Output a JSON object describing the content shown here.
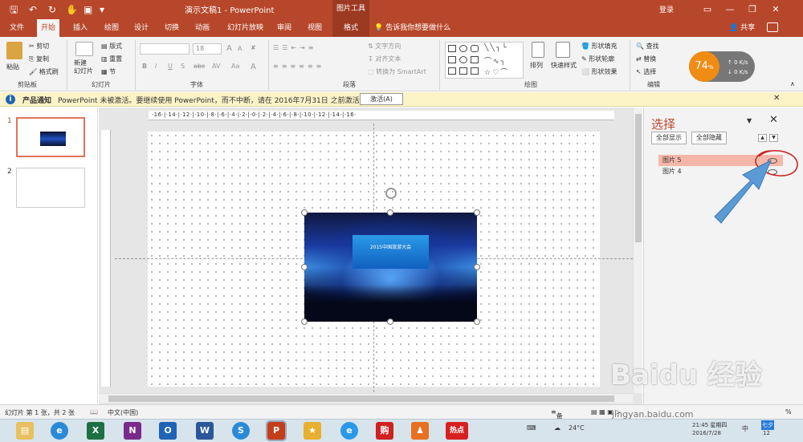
{
  "titlebar": {
    "title": "演示文稿1 - PowerPoint",
    "picture_tools": "图片工具",
    "login": "登录",
    "quick_access": [
      "save-icon",
      "undo-icon",
      "redo-icon",
      "touch-mode-icon",
      "customize-icon"
    ]
  },
  "tabs": {
    "file": "文件",
    "home": "开始",
    "insert": "插入",
    "draw": "绘图",
    "design": "设计",
    "transitions": "切换",
    "animations": "动画",
    "slideshow": "幻灯片放映",
    "review": "审阅",
    "view": "视图",
    "format": "格式",
    "tell_me": "告诉我你想要做什么",
    "share": "共享"
  },
  "ribbon": {
    "clipboard": {
      "label": "剪贴板",
      "paste": "粘贴",
      "cut": "剪切",
      "copy": "复制",
      "format_painter": "格式刷"
    },
    "slides": {
      "label": "幻灯片",
      "new_slide": "新建\n幻灯片",
      "layout": "版式",
      "reset": "重置",
      "section": "节"
    },
    "font": {
      "label": "字体",
      "font_name": "",
      "font_size": "18",
      "bold": "B",
      "italic": "I",
      "underline": "U",
      "strike": "S",
      "abc": "abc",
      "av": "AV",
      "aa": "Aa",
      "grow": "A",
      "shrink": "A"
    },
    "paragraph": {
      "label": "段落",
      "text_direction": "文字方向",
      "align_text": "对齐文本",
      "smartart": "转换为 SmartArt"
    },
    "drawing": {
      "label": "绘图",
      "arrange": "排列",
      "quick_styles": "快速样式",
      "fill": "形状填充",
      "outline": "形状轮廓",
      "effects": "形状效果"
    },
    "editing": {
      "label": "编辑",
      "find": "查找",
      "replace": "替换",
      "select": "选择"
    },
    "gauge": {
      "percent": "74",
      "percent_sign": "%",
      "up": "0 K/s",
      "down": "0 K/s"
    }
  },
  "notice": {
    "label": "产品通知",
    "message": "PowerPoint 未被激活。要继续使用 PowerPoint，而不中断，请在 2016年7月31日 之前激活。",
    "button": "激活(A)"
  },
  "thumbnails": {
    "first": "1",
    "second": "2"
  },
  "ruler": {
    "ticks": "·16·|·14·|·12·|·10·|·8·|·6·|·4·|·2·|·0·|·2·|·4·|·6·|·8·|·10·|·12·|·14·|·16·"
  },
  "photo": {
    "banner": "2015中国旅游大会"
  },
  "selection_pane": {
    "title": "选择",
    "show_all": "全部显示",
    "hide_all": "全部隐藏",
    "items": [
      {
        "label": "图片 5"
      },
      {
        "label": "图片 4"
      }
    ]
  },
  "status": {
    "slide_info": "幻灯片 第 1 张，共 2 张",
    "language": "中文(中国)",
    "notes": "备注",
    "zoom": "%"
  },
  "taskbar": {
    "temp": "24°C",
    "time": "21:45 星期四",
    "date": "2016/7/28",
    "lang": "中",
    "day": "七夕",
    "cal": "12"
  },
  "watermark": {
    "brand": "Baidu 经验",
    "url": "jingyan.baidu.com"
  },
  "colors": {
    "accent": "#b7472a",
    "selected": "#f5b8a8",
    "annotation_arrow": "#5b9bd5",
    "annotation_circle": "#cc2020"
  }
}
